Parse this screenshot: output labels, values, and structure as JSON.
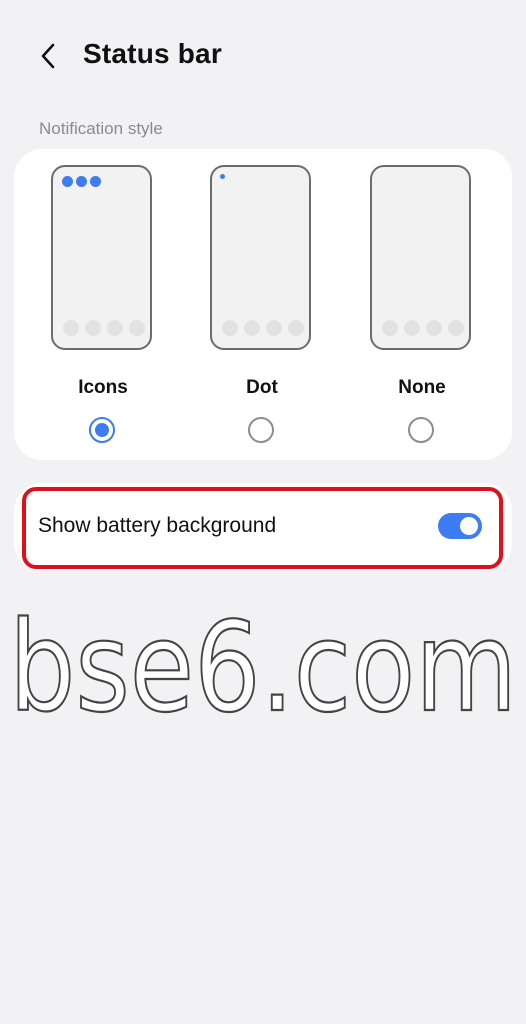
{
  "header": {
    "back_icon": "chevron-left-icon",
    "title": "Status bar"
  },
  "notification_style": {
    "label": "Notification style",
    "selected": "Icons",
    "options": [
      {
        "label": "Icons",
        "selected": true,
        "preview": "three-notification-icons"
      },
      {
        "label": "Dot",
        "selected": false,
        "preview": "single-dot"
      },
      {
        "label": "None",
        "selected": false,
        "preview": "empty"
      }
    ]
  },
  "battery": {
    "label": "Show battery background",
    "enabled": true,
    "highlight_color": "#e0101b"
  },
  "watermark": {
    "text": "bse6.com"
  },
  "colors": {
    "accent": "#3d7cf2",
    "background": "#f2f1f3",
    "card": "#ffffff"
  }
}
